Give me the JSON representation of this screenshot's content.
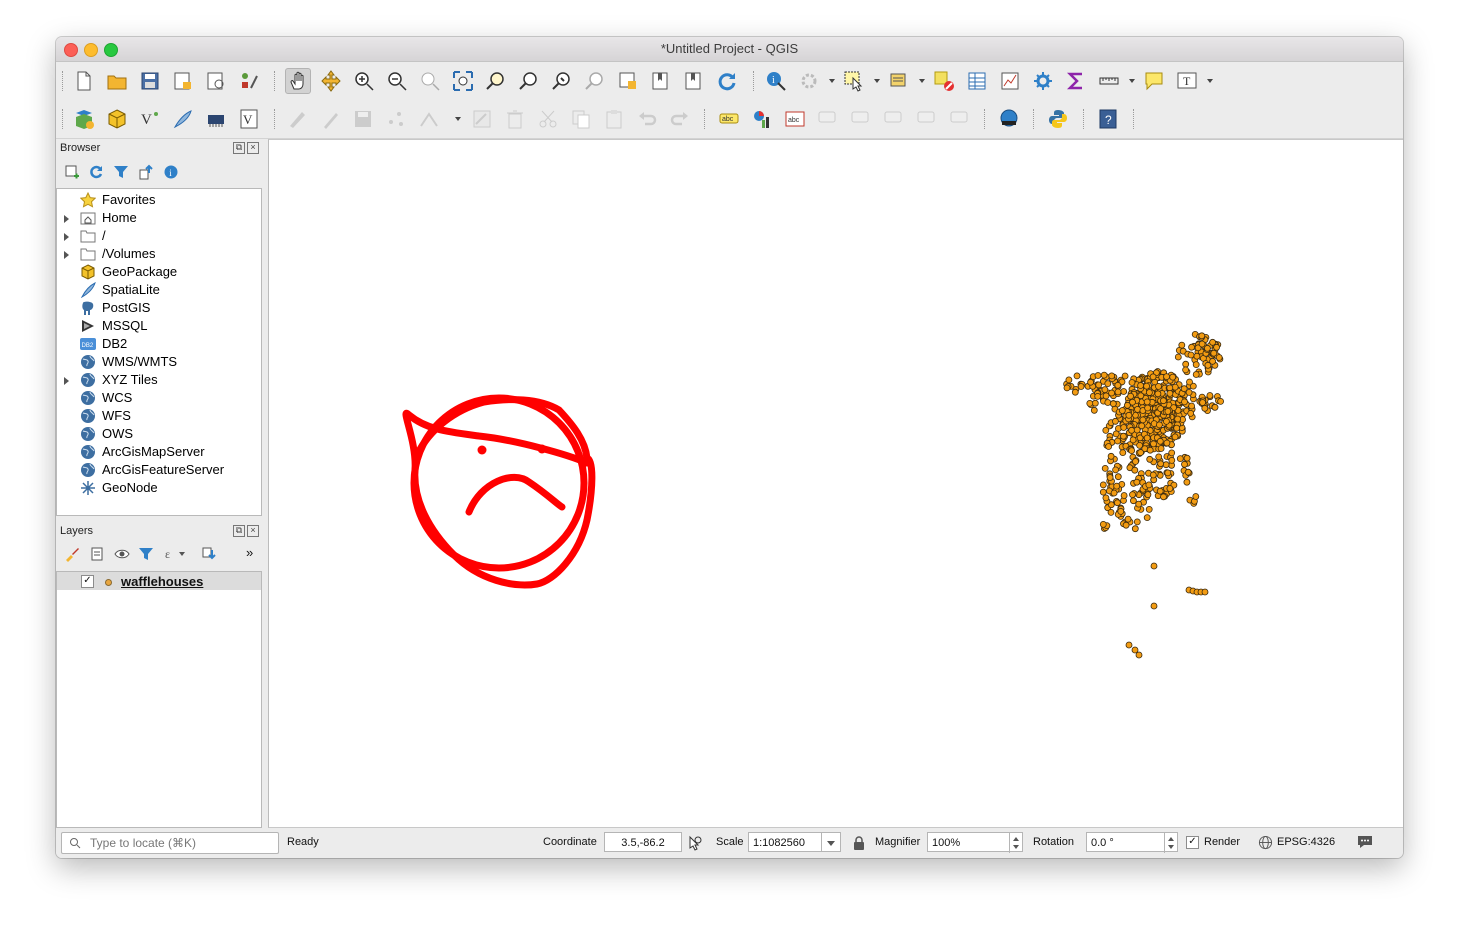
{
  "window": {
    "title": "*Untitled Project - QGIS"
  },
  "browser": {
    "title": "Browser",
    "items": [
      {
        "label": "Favorites",
        "icon": "star-icon",
        "expandable": false
      },
      {
        "label": "Home",
        "icon": "home-folder-icon",
        "expandable": true
      },
      {
        "label": "/",
        "icon": "folder-icon",
        "expandable": true
      },
      {
        "label": "/Volumes",
        "icon": "folder-icon",
        "expandable": true
      },
      {
        "label": "GeoPackage",
        "icon": "geopackage-icon",
        "expandable": false
      },
      {
        "label": "SpatiaLite",
        "icon": "spatialite-icon",
        "expandable": false
      },
      {
        "label": "PostGIS",
        "icon": "postgis-elephant-icon",
        "expandable": false
      },
      {
        "label": "MSSQL",
        "icon": "mssql-icon",
        "expandable": false
      },
      {
        "label": "DB2",
        "icon": "db2-icon",
        "expandable": false
      },
      {
        "label": "WMS/WMTS",
        "icon": "globe-icon",
        "expandable": false
      },
      {
        "label": "XYZ Tiles",
        "icon": "globe-icon",
        "expandable": true
      },
      {
        "label": "WCS",
        "icon": "globe-icon",
        "expandable": false
      },
      {
        "label": "WFS",
        "icon": "globe-icon",
        "expandable": false
      },
      {
        "label": "OWS",
        "icon": "globe-icon",
        "expandable": false
      },
      {
        "label": "ArcGisMapServer",
        "icon": "globe-icon",
        "expandable": false
      },
      {
        "label": "ArcGisFeatureServer",
        "icon": "globe-icon",
        "expandable": false
      },
      {
        "label": "GeoNode",
        "icon": "geonode-icon",
        "expandable": false
      }
    ]
  },
  "layers": {
    "title": "Layers",
    "items": [
      {
        "label": "wafflehouses",
        "checked": true
      }
    ]
  },
  "statusbar": {
    "locate_placeholder": "Type to locate (⌘K)",
    "status": "Ready",
    "coordinate_label": "Coordinate",
    "coordinate_value": "3.5,-86.2",
    "scale_label": "Scale",
    "scale_value": "1:1082560",
    "magnifier_label": "Magnifier",
    "magnifier_value": "100%",
    "rotation_label": "Rotation",
    "rotation_value": "0.0 °",
    "render_label": "Render",
    "render_checked": true,
    "crs": "EPSG:4326"
  },
  "colors": {
    "accent": "#f5a21b",
    "annotation": "#ff0000",
    "point_fill": "#f39c12",
    "point_stroke": "#3a2a10"
  }
}
